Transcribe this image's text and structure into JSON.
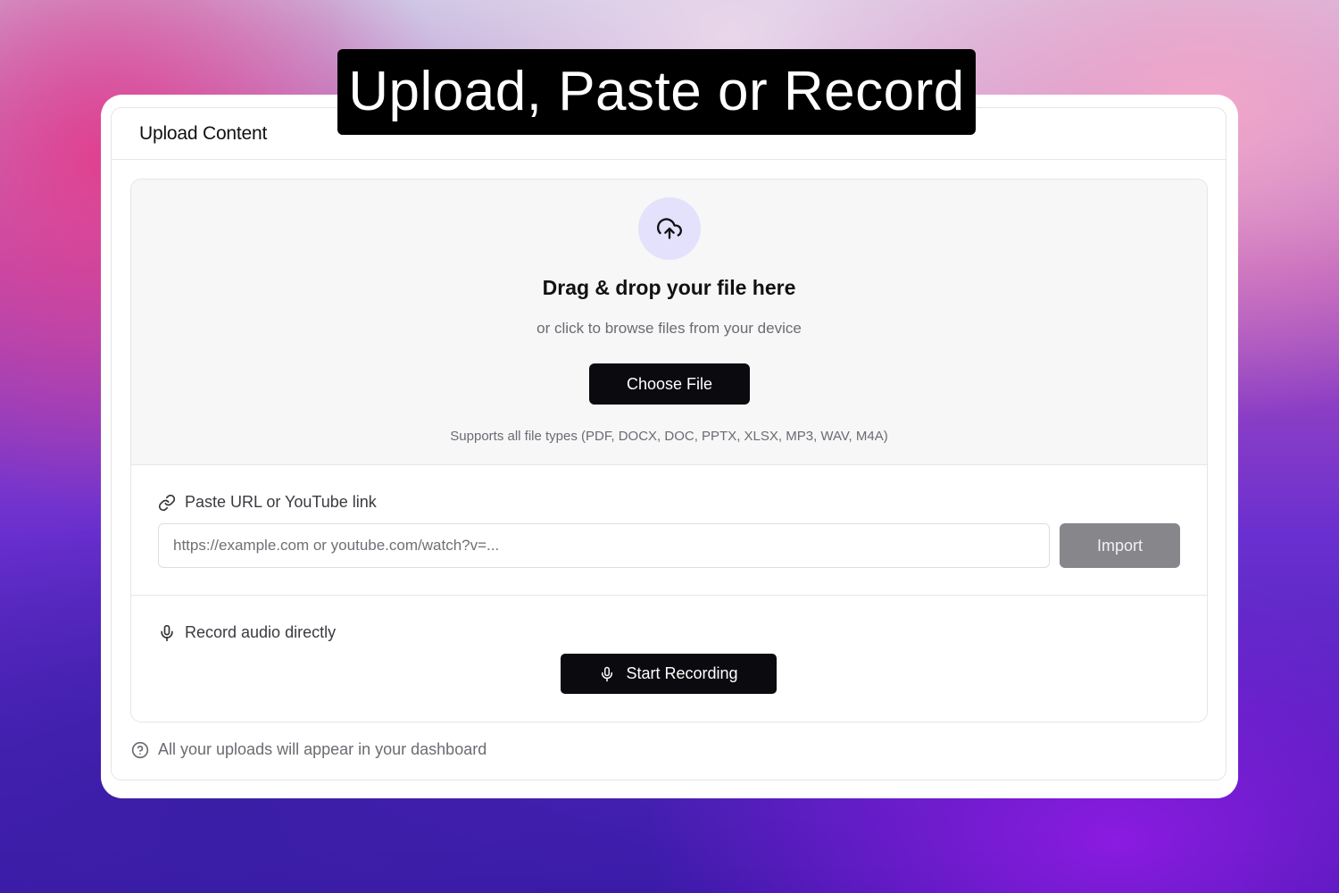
{
  "headline": "Upload, Paste or Record",
  "card": {
    "title": "Upload Content"
  },
  "dropzone": {
    "icon": "cloud-upload-icon",
    "title": "Drag & drop your file here",
    "subtitle": "or click to browse files from your device",
    "button_label": "Choose File",
    "supports": "Supports all file types (PDF, DOCX, DOC, PPTX, XLSX, MP3, WAV, M4A)"
  },
  "url": {
    "icon": "link-icon",
    "label": "Paste URL or YouTube link",
    "placeholder": "https://example.com or youtube.com/watch?v=...",
    "value": "",
    "button_label": "Import"
  },
  "record": {
    "icon": "microphone-icon",
    "label": "Record audio directly",
    "button_label": "Start Recording"
  },
  "footer": {
    "icon": "help-circle-icon",
    "text": "All your uploads will appear in your dashboard"
  },
  "colors": {
    "primary_button": "#0b0b0f",
    "disabled_button": "#86868b",
    "icon_circle": "#e3e1fb"
  }
}
